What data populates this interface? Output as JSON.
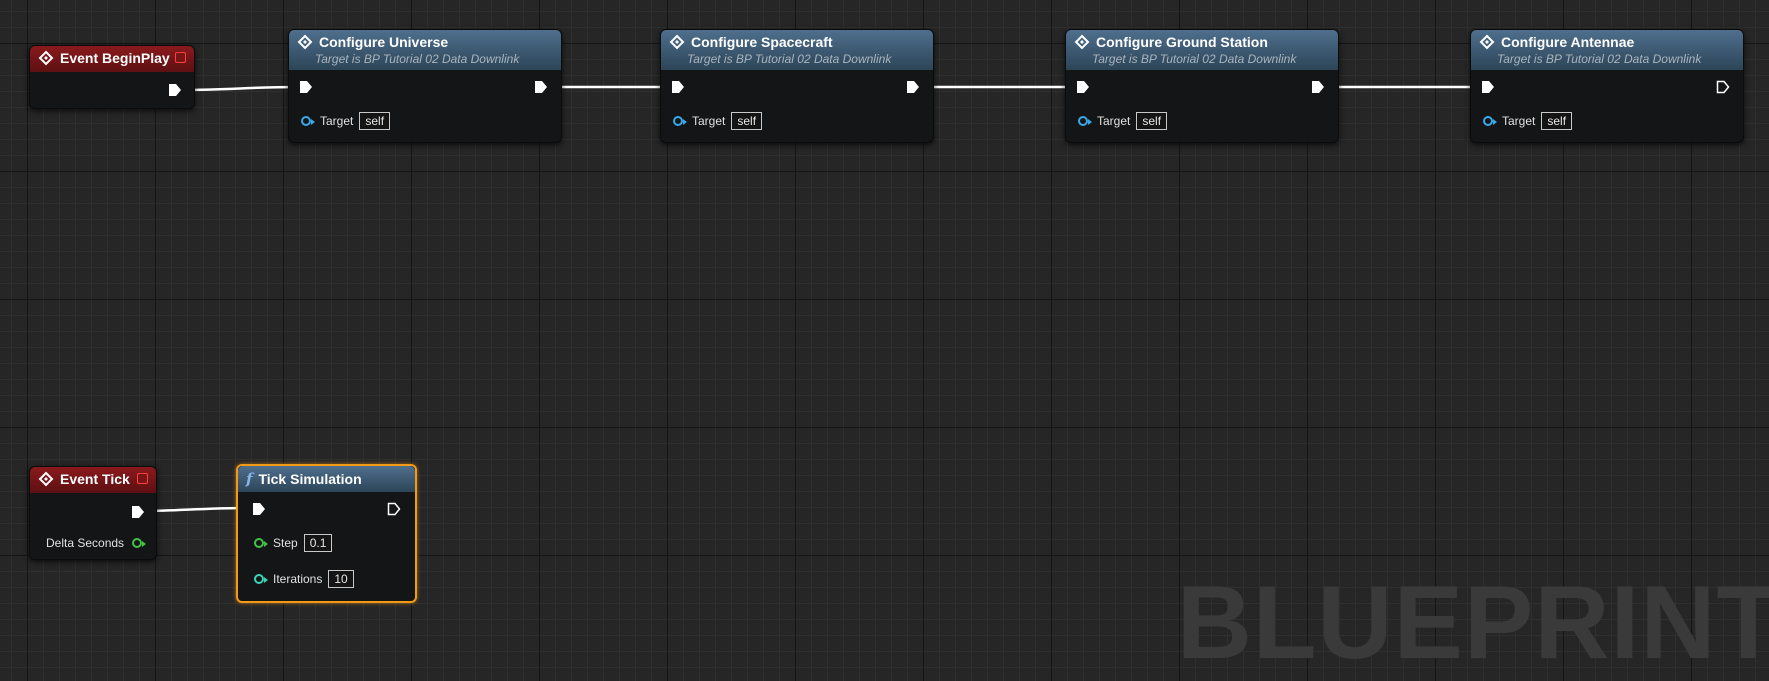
{
  "watermark": "BLUEPRINT",
  "colors": {
    "event_header": "#8a1a1d",
    "function_header": "#4f6f8d",
    "selection": "#f29a16",
    "object_pin": "#3aa8e8",
    "float_pin": "#42c244",
    "int_pin": "#3bd2b5",
    "exec_wire": "#ffffff"
  },
  "nodes": {
    "begin_play": {
      "title": "Event BeginPlay",
      "icon": "event-diamond-icon"
    },
    "configure_universe": {
      "title": "Configure Universe",
      "subtitle": "Target is BP Tutorial 02 Data Downlink",
      "pin_label": "Target",
      "pin_value": "self"
    },
    "configure_spacecraft": {
      "title": "Configure Spacecraft",
      "subtitle": "Target is BP Tutorial 02 Data Downlink",
      "pin_label": "Target",
      "pin_value": "self"
    },
    "configure_ground_station": {
      "title": "Configure Ground Station",
      "subtitle": "Target is BP Tutorial 02 Data Downlink",
      "pin_label": "Target",
      "pin_value": "self"
    },
    "configure_antennae": {
      "title": "Configure Antennae",
      "subtitle": "Target is BP Tutorial 02 Data Downlink",
      "pin_label": "Target",
      "pin_value": "self"
    },
    "event_tick": {
      "title": "Event Tick",
      "pin_label": "Delta Seconds"
    },
    "tick_simulation": {
      "title": "Tick Simulation",
      "icon": "f",
      "step_label": "Step",
      "step_value": "0.1",
      "iterations_label": "Iterations",
      "iterations_value": "10"
    }
  }
}
